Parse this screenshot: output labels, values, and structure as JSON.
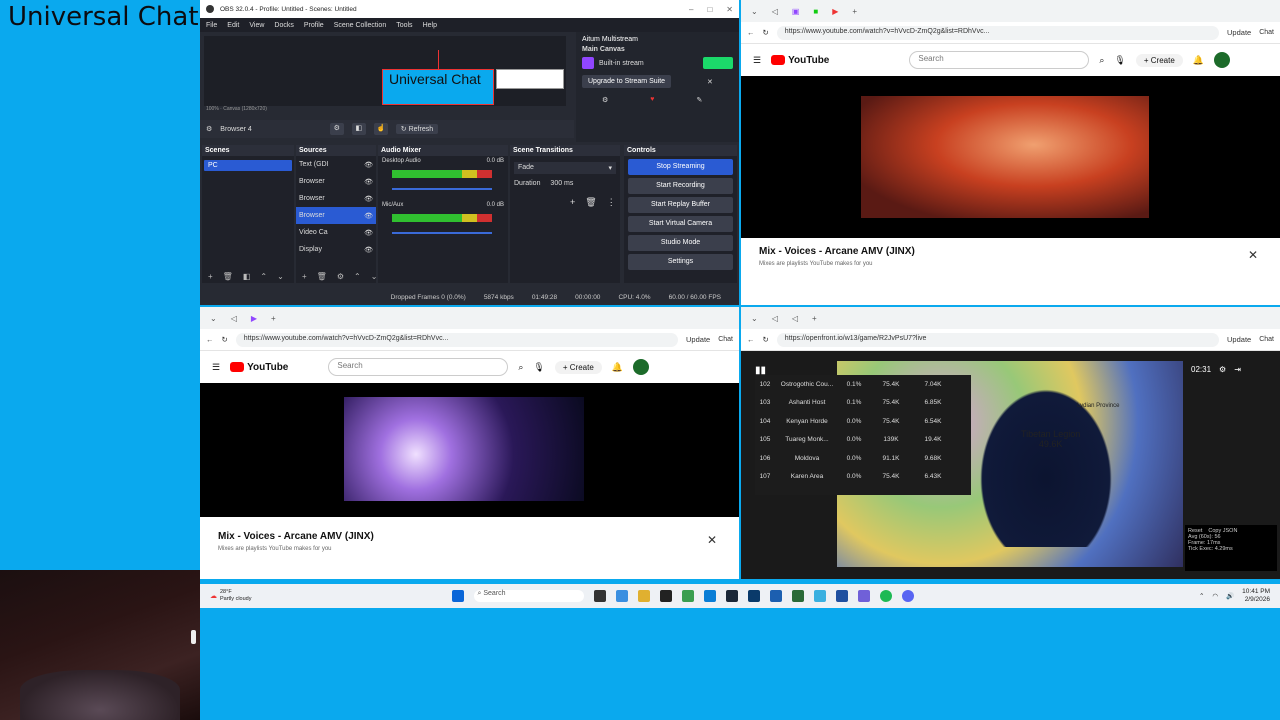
{
  "overlay": {
    "title": "Universal Chat"
  },
  "obs": {
    "window_title": "OBS 32.0.4 - Profile: Untitled - Scenes: Untitled",
    "menu": [
      "File",
      "Edit",
      "View",
      "Docks",
      "Profile",
      "Scene Collection",
      "Tools",
      "Help"
    ],
    "preview_text": "Universal Chat",
    "zoom": "100%",
    "canvas_label": "Canvas (1280x720)",
    "source_name": "Browser 4",
    "refresh_label": "Refresh",
    "multistream": {
      "title": "Aitum Multistream",
      "main_canvas": "Main Canvas",
      "builtin": "Built-in stream",
      "upgrade": "Upgrade to Stream Suite"
    },
    "docks": {
      "scenes": {
        "title": "Scenes",
        "items": [
          "PC"
        ]
      },
      "sources": {
        "title": "Sources",
        "items": [
          "Text (GDI",
          "Browser",
          "Browser",
          "Browser",
          "Video Ca",
          "Display"
        ]
      },
      "mixer": {
        "title": "Audio Mixer",
        "channels": [
          {
            "name": "Desktop Audio",
            "db": "0.0 dB"
          },
          {
            "name": "Mic/Aux",
            "db": "0.0 dB"
          }
        ]
      },
      "transitions": {
        "title": "Scene Transitions",
        "type": "Fade",
        "duration_label": "Duration",
        "duration": "300 ms"
      },
      "controls": {
        "title": "Controls",
        "buttons": [
          "Stop Streaming",
          "Start Recording",
          "Start Replay Buffer",
          "Start Virtual Camera",
          "Studio Mode",
          "Settings"
        ]
      }
    },
    "status": {
      "dropped": "Dropped Frames 0 (0.0%)",
      "kbps": "5874 kbps",
      "stream_time": "01:49:28",
      "rec_time": "00:00:00",
      "cpu": "CPU: 4.0%",
      "fps": "60.00 / 60.00 FPS"
    }
  },
  "browser_yt_top": {
    "url": "https://www.youtube.com/watch?v=hVvcD-ZmQ2g&list=RDhVvc...",
    "update": "Update",
    "chat": "Chat",
    "search_placeholder": "Search",
    "create": "Create",
    "playlist_title": "Mix - Voices - Arcane AMV (JINX)",
    "playlist_sub": "Mixes are playlists YouTube makes for you"
  },
  "browser_yt_bottom": {
    "url": "https://www.youtube.com/watch?v=hVvcD-ZmQ2g&list=RDhVvc...",
    "update": "Update",
    "chat": "Chat",
    "search_placeholder": "Search",
    "create": "Create",
    "playlist_title": "Mix - Voices - Arcane AMV (JINX)",
    "playlist_sub": "Mixes are playlists YouTube makes for you"
  },
  "browser_game": {
    "url": "https://openfront.io/w13/game/R2JvPsU7?live",
    "update": "Update",
    "chat": "Chat",
    "timer": "02:31",
    "leaderboard": [
      {
        "rank": "102",
        "name": "Ostrogothic Cou...",
        "pct": "0.1%",
        "gold": "75.4K",
        "troops": "7.04K"
      },
      {
        "rank": "103",
        "name": "Ashanti Host",
        "pct": "0.1%",
        "gold": "75.4K",
        "troops": "6.85K"
      },
      {
        "rank": "104",
        "name": "Kenyan Horde",
        "pct": "0.0%",
        "gold": "75.4K",
        "troops": "6.54K"
      },
      {
        "rank": "105",
        "name": "Tuareg Monk...",
        "pct": "0.0%",
        "gold": "139K",
        "troops": "19.4K"
      },
      {
        "rank": "106",
        "name": "Moldova",
        "pct": "0.0%",
        "gold": "91.1K",
        "troops": "9.68K"
      },
      {
        "rank": "107",
        "name": "Karen Area",
        "pct": "0.0%",
        "gold": "75.4K",
        "troops": "6.43K"
      }
    ],
    "map_labels": {
      "legion": "Tibetan Legion",
      "legion_val": "49.6K",
      "province": "Lydian Province"
    },
    "perf": {
      "reset": "Reset",
      "copy": "Copy JSON",
      "avg": "Avg (60s): 56",
      "frame": "Frame: 17ms",
      "tick": "Tick Exec: 4.29ms"
    }
  },
  "taskbar": {
    "weather_temp": "28°F",
    "weather": "Partly cloudy",
    "search": "Search",
    "time": "10:41 PM",
    "date": "2/9/2026"
  }
}
